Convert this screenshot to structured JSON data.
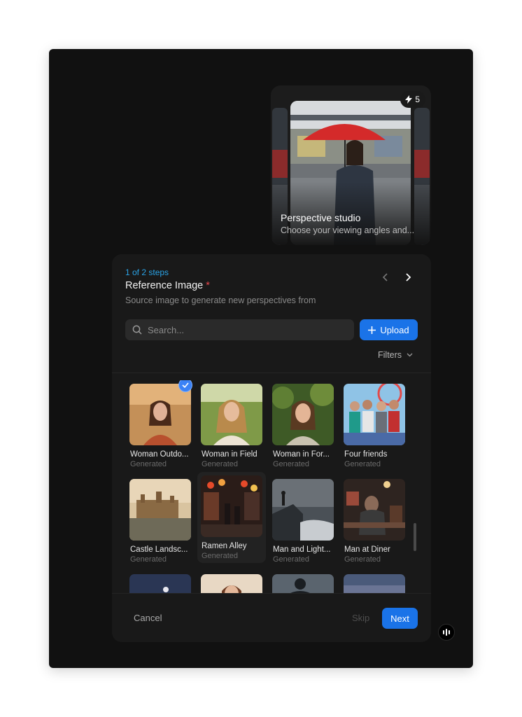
{
  "hero": {
    "badge_count": "5",
    "title": "Perspective studio",
    "subtitle": "Choose your viewing angles and..."
  },
  "wizard": {
    "step": "1 of 2 steps",
    "title": "Reference Image",
    "required_mark": "*",
    "description": "Source image to generate new perspectives from",
    "search_placeholder": "Search...",
    "upload_label": "Upload",
    "filters_label": "Filters"
  },
  "items": [
    {
      "name": "Woman Outdo...",
      "sub": "Generated",
      "selected": true
    },
    {
      "name": "Woman in Field",
      "sub": "Generated"
    },
    {
      "name": "Woman in For...",
      "sub": "Generated"
    },
    {
      "name": "Four friends",
      "sub": "Generated"
    },
    {
      "name": "Castle Landsc...",
      "sub": "Generated"
    },
    {
      "name": "Ramen Alley",
      "sub": "Generated"
    },
    {
      "name": "Man and Light...",
      "sub": "Generated"
    },
    {
      "name": "Man at Diner",
      "sub": "Generated"
    }
  ],
  "footer": {
    "cancel_label": "Cancel",
    "skip_label": "Skip",
    "next_label": "Next"
  },
  "colors": {
    "accent": "#1a73e8",
    "step_text": "#2aa3e6",
    "required": "#e5484d"
  }
}
